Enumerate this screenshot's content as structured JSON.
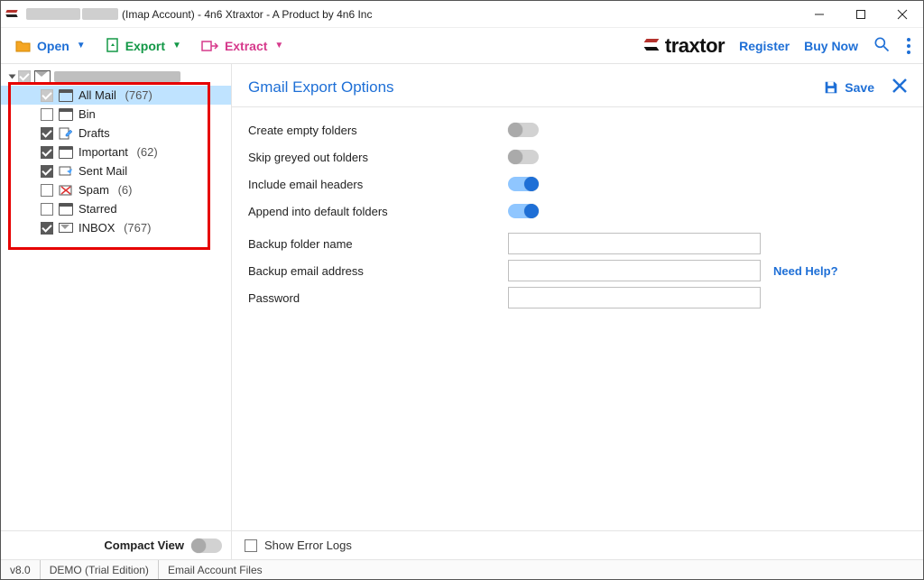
{
  "titlebar": {
    "suffix": "(Imap Account) - 4n6 Xtraxtor - A Product by 4n6 Inc"
  },
  "toolbar": {
    "open": "Open",
    "export": "Export",
    "extract": "Extract",
    "register": "Register",
    "buy_now": "Buy Now",
    "logo_text_a": "traxtor"
  },
  "sidebar": {
    "items": [
      {
        "label": "All Mail",
        "count": "(767)",
        "checked": true,
        "greyed": true,
        "icon": "folder",
        "selected": true
      },
      {
        "label": "Bin",
        "count": "",
        "checked": false,
        "icon": "folder"
      },
      {
        "label": "Drafts",
        "count": "",
        "checked": true,
        "icon": "draft"
      },
      {
        "label": "Important",
        "count": "(62)",
        "checked": true,
        "icon": "folder"
      },
      {
        "label": "Sent Mail",
        "count": "",
        "checked": true,
        "icon": "sent"
      },
      {
        "label": "Spam",
        "count": "(6)",
        "checked": false,
        "icon": "spam"
      },
      {
        "label": "Starred",
        "count": "",
        "checked": false,
        "icon": "folder"
      },
      {
        "label": "INBOX",
        "count": "(767)",
        "checked": true,
        "icon": "mail"
      }
    ],
    "compact_view": "Compact View"
  },
  "panel": {
    "title": "Gmail Export Options",
    "save": "Save",
    "opts": {
      "create_empty": "Create empty folders",
      "skip_greyed": "Skip greyed out folders",
      "include_headers": "Include email headers",
      "append_default": "Append into default folders",
      "backup_folder": "Backup folder name",
      "backup_email": "Backup email address",
      "password": "Password",
      "help": "Need Help?"
    },
    "show_error_logs": "Show Error Logs"
  },
  "status": {
    "ver": "v8.0",
    "edition": "DEMO (Trial Edition)",
    "files": "Email Account Files"
  }
}
